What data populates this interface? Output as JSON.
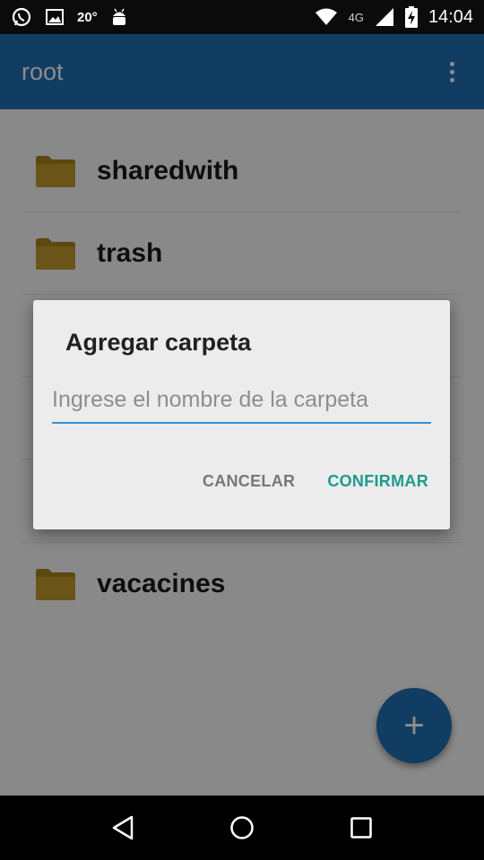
{
  "status_bar": {
    "temperature": "20°",
    "network": "4G",
    "time": "14:04",
    "icons": [
      "whatsapp-icon",
      "image-icon",
      "android-icon",
      "wifi-icon",
      "signal-icon",
      "battery-charging-icon"
    ]
  },
  "app_bar": {
    "title": "root",
    "overflow_icon": "more-vert-icon"
  },
  "folders": [
    {
      "name": "sharedwith"
    },
    {
      "name": "trash"
    },
    {
      "name": ""
    },
    {
      "name": ""
    },
    {
      "name": "vacacines"
    }
  ],
  "dialog": {
    "title": "Agregar carpeta",
    "input_value": "",
    "input_placeholder": "Ingrese el nombre de la carpeta",
    "cancel_label": "CANCELAR",
    "confirm_label": "CONFIRMAR"
  },
  "fab": {
    "label": "+",
    "icon": "add-icon"
  },
  "nav_bar": {
    "icons": [
      "back-icon",
      "home-icon",
      "recents-icon"
    ]
  },
  "colors": {
    "primary": "#1f6fb3",
    "accent": "#1e9a8e",
    "folder": "#c29a2c"
  }
}
